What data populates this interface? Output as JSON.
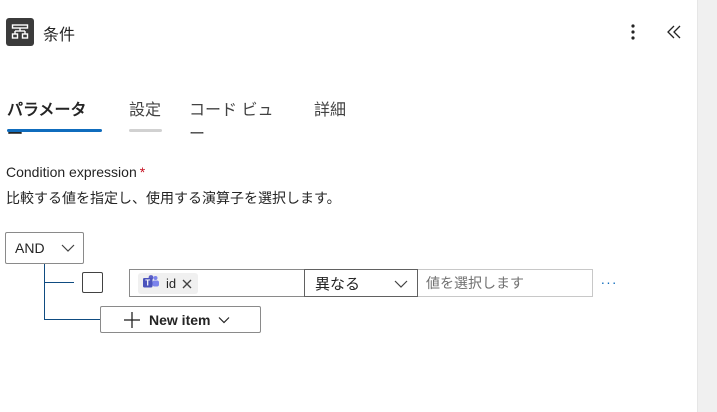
{
  "header": {
    "title": "条件",
    "icon": "condition-icon",
    "more_icon": "more-vertical-icon",
    "collapse_icon": "double-chevron-left-icon"
  },
  "tabs": [
    {
      "label": "パラメーター",
      "active": true
    },
    {
      "label": "設定",
      "active": false
    },
    {
      "label": "コード ビュー",
      "active": false
    },
    {
      "label": "詳細",
      "active": false
    }
  ],
  "condition": {
    "label": "Condition expression",
    "required_mark": "*",
    "description": "比較する値を指定し、使用する演算子を選択します。",
    "group_operator": "AND",
    "row": {
      "checked": false,
      "token_label": "id",
      "token_icon": "teams-icon",
      "operator": "異なる",
      "value_placeholder": "値を選択します",
      "more_label": "···"
    },
    "new_item_label": "New item"
  },
  "colors": {
    "accent": "#0f6cbd",
    "tree_line": "#0f4c81",
    "required": "#c50f1f",
    "teams": "#5b5fc7"
  }
}
